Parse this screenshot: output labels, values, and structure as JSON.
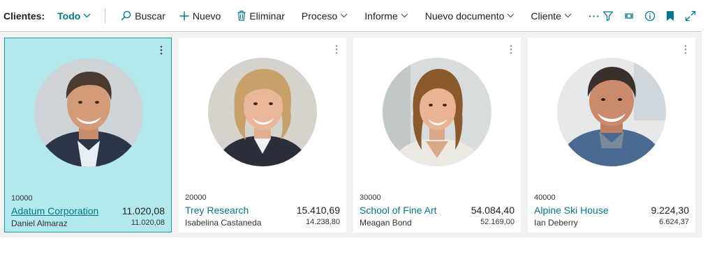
{
  "toolbar": {
    "title": "Clientes:",
    "view": "Todo",
    "search": "Buscar",
    "new": "Nuevo",
    "delete": "Eliminar",
    "process": "Proceso",
    "report": "Informe",
    "new_document": "Nuevo documento",
    "customer": "Cliente",
    "more": "···"
  },
  "colors": {
    "accent": "#00788a",
    "selected_bg": "#b3e8ec",
    "selected_border": "#1a9aa6"
  },
  "cards": [
    {
      "number": "10000",
      "name": "Adatum Corporation",
      "balance": "11.020,08",
      "contact": "Daniel Almaraz",
      "balance_due": "11.020,08",
      "selected": true
    },
    {
      "number": "20000",
      "name": "Trey Research",
      "balance": "15.410,69",
      "contact": "Isabelina Castaneda",
      "balance_due": "14.238,80",
      "selected": false
    },
    {
      "number": "30000",
      "name": "School of Fine Art",
      "balance": "54.084,40",
      "contact": "Meagan Bond",
      "balance_due": "52.169,00",
      "selected": false
    },
    {
      "number": "40000",
      "name": "Alpine Ski House",
      "balance": "9.224,30",
      "contact": "Ian Deberry",
      "balance_due": "6.624,37",
      "selected": false
    }
  ]
}
